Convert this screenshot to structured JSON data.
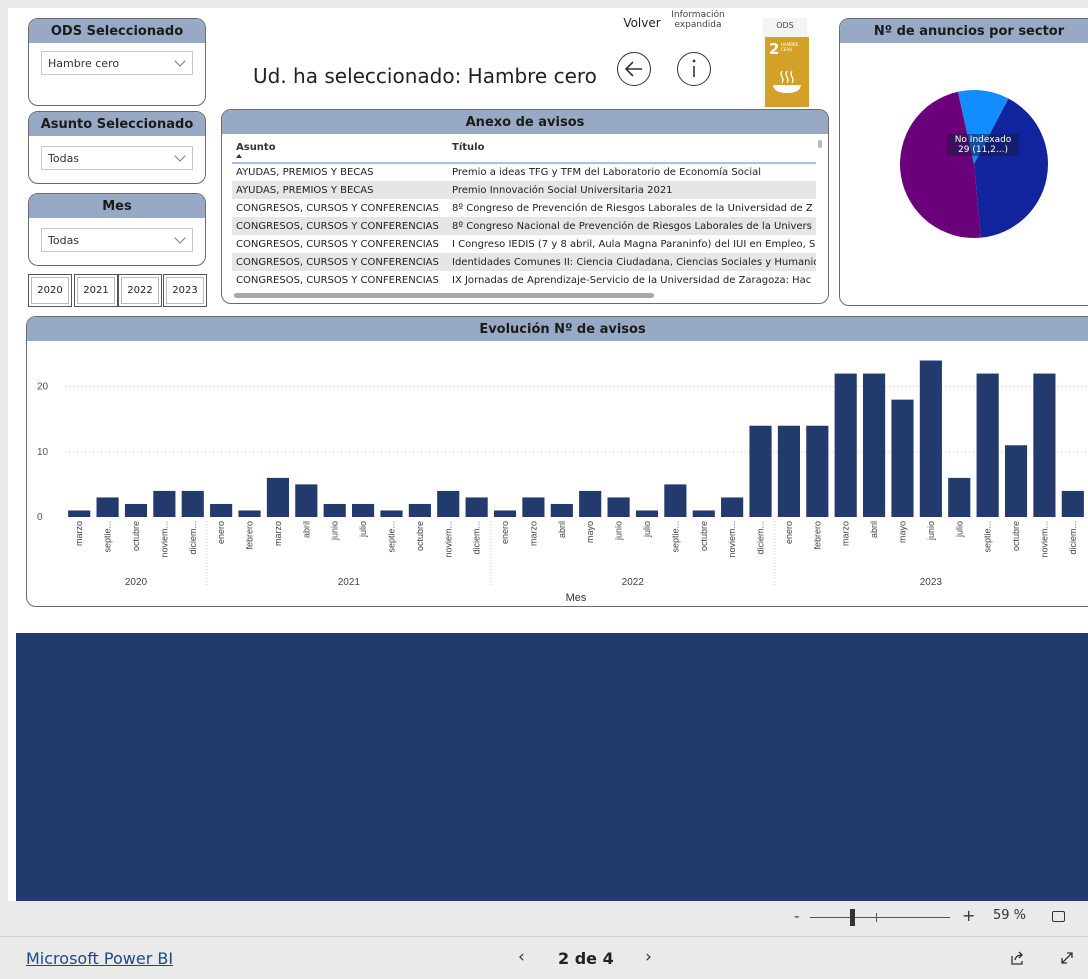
{
  "filters": {
    "ods": {
      "title": "ODS Seleccionado",
      "value": "Hambre cero"
    },
    "asunto": {
      "title": "Asunto Seleccionado",
      "value": "Todas"
    },
    "mes": {
      "title": "Mes",
      "value": "Todas"
    },
    "years": [
      "2020",
      "2021",
      "2022",
      "2023"
    ]
  },
  "header": {
    "selection_text": "Ud. ha seleccionado: Hambre cero",
    "back_label": "Volver",
    "info_label_line1": "Información",
    "info_label_line2": "expandida",
    "ods_label": "ODS",
    "ods_badge_number": "2",
    "ods_badge_text1": "HAMBRE",
    "ods_badge_text2": "CERO"
  },
  "annex": {
    "title": "Anexo de avisos",
    "columns": [
      "Asunto",
      "Título"
    ],
    "rows": [
      [
        "AYUDAS, PREMIOS Y BECAS",
        "Premio a ideas TFG y TFM del Laboratorio de Economía Social"
      ],
      [
        "AYUDAS, PREMIOS Y BECAS",
        "Premio Innovación Social Universitaria 2021"
      ],
      [
        "CONGRESOS, CURSOS Y CONFERENCIAS",
        "8º Congreso de Prevención de Riesgos Laborales de la Universidad de Z"
      ],
      [
        "CONGRESOS, CURSOS Y CONFERENCIAS",
        "8º Congreso Nacional de Prevención de Riesgos Laborales de la Univers"
      ],
      [
        "CONGRESOS, CURSOS Y CONFERENCIAS",
        "I Congreso IEDIS (7 y 8 abril, Aula Magna Paraninfo) del IUI en Empleo, S"
      ],
      [
        "CONGRESOS, CURSOS Y CONFERENCIAS",
        "Identidades Comunes II: Ciencia Ciudadana, Ciencias Sociales y Humanic"
      ],
      [
        "CONGRESOS, CURSOS Y CONFERENCIAS",
        "IX Jornadas de Aprendizaje-Servicio de la Universidad de Zaragoza: Hac"
      ]
    ]
  },
  "pie": {
    "title": "Nº de anuncios por sector",
    "tooltip_line1": "No Indexado",
    "tooltip_line2": "29 (11,2...)",
    "colors": [
      "#118dff",
      "#12239e",
      "#6b007b"
    ],
    "slices": [
      11.2,
      40.8,
      48.0
    ]
  },
  "chart_data": {
    "type": "bar",
    "title": "Evolución Nº de avisos",
    "xlabel": "Mes",
    "ylabel": "",
    "ylim": [
      0,
      25
    ],
    "yticks": [
      0,
      10,
      20
    ],
    "bar_color": "#223a6c",
    "categories": [
      "marzo",
      "septie...",
      "octubre",
      "noviem...",
      "diciem...",
      "enero",
      "febrero",
      "marzo",
      "abril",
      "junio",
      "julio",
      "septie...",
      "octubre",
      "noviem...",
      "diciem...",
      "enero",
      "marzo",
      "abril",
      "mayo",
      "junio",
      "julio",
      "septie...",
      "octubre",
      "noviem...",
      "diciem...",
      "enero",
      "febrero",
      "marzo",
      "abril",
      "mayo",
      "junio",
      "julio",
      "septie...",
      "octubre",
      "noviem...",
      "diciem..."
    ],
    "values": [
      1,
      3,
      2,
      4,
      4,
      2,
      1,
      6,
      5,
      2,
      2,
      1,
      2,
      4,
      3,
      1,
      3,
      2,
      4,
      3,
      1,
      5,
      1,
      3,
      14,
      14,
      14,
      22,
      22,
      18,
      24,
      6,
      22,
      11,
      22,
      4
    ],
    "years": [
      {
        "label": "2020",
        "count": 5
      },
      {
        "label": "2021",
        "count": 10
      },
      {
        "label": "2022",
        "count": 10
      },
      {
        "label": "2023",
        "count": 11
      }
    ]
  },
  "footer": {
    "brand": "Microsoft Power BI",
    "page_indicator": "2 de 4",
    "zoom_minus": "-",
    "zoom_plus": "+",
    "zoom_level": "59 %",
    "zoom_fraction": 0.3
  }
}
